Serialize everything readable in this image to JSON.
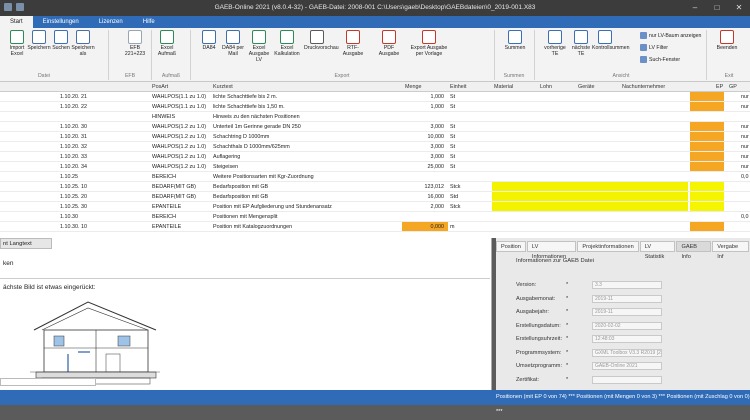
{
  "window": {
    "title": "GAEB-Online 2021 (v8.0.4-32) - GAEB-Datei: 2008-001 C:\\Users\\gaeb\\Desktop\\GAEBdateien\\0_2019-001.X83"
  },
  "menu": [
    "Start",
    "Einstellungen",
    "Lizenzen",
    "Hilfe"
  ],
  "ribbon": {
    "buttons": [
      {
        "label": "Import\nExcel",
        "icon": "import-excel-icon",
        "color": "#2e8b57"
      },
      {
        "label": "Speichern",
        "icon": "save-icon",
        "color": "#4a6fa5"
      },
      {
        "label": "Suchen",
        "icon": "search-icon",
        "color": "#3b6fb8"
      },
      {
        "label": "Speichern\nals",
        "icon": "save-as-icon",
        "color": "#4a6fa5"
      },
      {
        "label": "EFB 221+223",
        "icon": "efb-icon",
        "color": "#9aa6b5"
      },
      {
        "label": "Excel\nAufmaß",
        "icon": "excel-aufmass-icon",
        "color": "#2e8b57"
      },
      {
        "label": "DA84",
        "icon": "da84-icon",
        "color": "#3e6fa8"
      },
      {
        "label": "DA84 per\nMail",
        "icon": "mail-icon",
        "color": "#3e6fa8"
      },
      {
        "label": "Excel\nAusgabe LV",
        "icon": "excel-lv-icon",
        "color": "#2e8b57"
      },
      {
        "label": "Excel\nKalkulation",
        "icon": "excel-calc-icon",
        "color": "#2e8b57"
      },
      {
        "label": "Druckvorschau",
        "icon": "print-preview-icon",
        "color": "#5a5a5a"
      },
      {
        "label": "RTF-Ausgabe",
        "icon": "rtf-icon",
        "color": "#c0392b"
      },
      {
        "label": "PDF Ausgabe",
        "icon": "pdf-icon",
        "color": "#c0392b"
      },
      {
        "label": "Export Ausgabe\nper Vorlage",
        "icon": "template-export-icon",
        "color": "#c0392b"
      },
      {
        "label": "Summen",
        "icon": "sum-icon",
        "color": "#3b6fb8"
      },
      {
        "label": "vorherige\nTE",
        "icon": "prev-icon",
        "color": "#3b6fb8"
      },
      {
        "label": "nächste\nTE",
        "icon": "next-icon",
        "color": "#3b6fb8"
      },
      {
        "label": "Kontrollsummen",
        "icon": "checksum-icon",
        "color": "#3b6fb8"
      },
      {
        "label": "Beenden",
        "icon": "exit-icon",
        "color": "#c0392b"
      }
    ],
    "small": [
      "nur LV-Baum anzeigen",
      "LV Filter",
      "Such-Fenster"
    ],
    "groups": [
      "Datei",
      "EFB",
      "Aufmaß",
      "Export",
      "Summen",
      "Ansicht",
      "Exit"
    ]
  },
  "grid": {
    "headers": [
      "PosArt",
      "Kurztext",
      "Menge",
      "Einheit",
      "Material",
      "Lohn",
      "Geräte",
      "Nachunternehmer",
      "EP",
      "GP"
    ],
    "rows": [
      {
        "oz": "1.10.20.  21",
        "posart": "WAHLPOS(1.1 zu 1.0)",
        "text": "lichte Schachttiefe bis 2 m.",
        "menge": "1,000",
        "einheit": "St",
        "gp": "nur",
        "ep_color": "#f5a623",
        "hl": ""
      },
      {
        "oz": "1.10.20.  22",
        "posart": "WAHLPOS(1.1 zu 1.0)",
        "text": "lichte Schachttiefe bis 1,50 m.",
        "menge": "1,000",
        "einheit": "St",
        "gp": "nur",
        "ep_color": "#f5a623",
        "hl": ""
      },
      {
        "oz": "",
        "posart": "HINWEIS",
        "text": "Hinweis zu den nächsten Positionen",
        "menge": "",
        "einheit": "",
        "gp": "",
        "ep_color": "",
        "hl": ""
      },
      {
        "oz": "1.10.20.  30",
        "posart": "WAHLPOS(1.2 zu 1.0)",
        "text": "Unterteil 1m Gerinne gerade DN 250",
        "menge": "3,000",
        "einheit": "St",
        "gp": "nur",
        "ep_color": "#f5a623",
        "hl": ""
      },
      {
        "oz": "1.10.20.  31",
        "posart": "WAHLPOS(1.2 zu 1.0)",
        "text": "Schachtring D 1000mm",
        "menge": "10,000",
        "einheit": "St",
        "gp": "nur",
        "ep_color": "#f5a623",
        "hl": ""
      },
      {
        "oz": "1.10.20.  32",
        "posart": "WAHLPOS(1.2 zu 1.0)",
        "text": "Schachthals D 1000mm/625mm",
        "menge": "3,000",
        "einheit": "St",
        "gp": "nur",
        "ep_color": "#f5a623",
        "hl": ""
      },
      {
        "oz": "1.10.20.  33",
        "posart": "WAHLPOS(1.2 zu 1.0)",
        "text": "Auflagering",
        "menge": "3,000",
        "einheit": "St",
        "gp": "nur",
        "ep_color": "#f5a623",
        "hl": ""
      },
      {
        "oz": "1.10.20.  34",
        "posart": "WAHLPOS(1.2 zu 1.0)",
        "text": "Steigeisen",
        "menge": "25,000",
        "einheit": "St",
        "gp": "nur",
        "ep_color": "#f5a623",
        "hl": ""
      },
      {
        "oz": "1.10.25",
        "posart": "BEREICH",
        "text": "Weitere Positionsarten mit Kgr-Zuordnung",
        "menge": "",
        "einheit": "",
        "gp": "0,0",
        "ep_color": "",
        "hl": ""
      },
      {
        "oz": "1.10.25.  10",
        "posart": "BEDARF(MIT GB)",
        "text": "Bedarfsposition mit GB",
        "menge": "123,012",
        "einheit": "Stck",
        "gp": "",
        "ep_color": "#f5f500",
        "hl": "yellow"
      },
      {
        "oz": "1.10.25.  20",
        "posart": "BEDARF(MIT GB)",
        "text": "Bedarfsposition mit GB",
        "menge": "16,000",
        "einheit": "Std",
        "gp": "",
        "ep_color": "#f5f500",
        "hl": "yellow"
      },
      {
        "oz": "1.10.25.  30",
        "posart": "EPANTEILE",
        "text": "Position mit EP Aufgliederung und Stundenansatz",
        "menge": "2,000",
        "einheit": "Stck",
        "gp": "",
        "ep_color": "#f5f500",
        "hl": "yellow"
      },
      {
        "oz": "1.10.30",
        "posart": "BEREICH",
        "text": "Positionen mit Mengensplit",
        "menge": "",
        "einheit": "",
        "gp": "0,0",
        "ep_color": "",
        "hl": ""
      },
      {
        "oz": "1.10.30.  10",
        "posart": "EPANTEILE",
        "text": "Position mit Katalogzuordnungen",
        "menge": "0,000",
        "einheit": "m",
        "gp": "",
        "ep_color": "#f5a623",
        "hl": "menge"
      }
    ]
  },
  "leftpane": {
    "tab": "nt Langtext",
    "line1": "ken",
    "line2": "ächste Bild ist etwas eingerückt:"
  },
  "rightpane": {
    "tabs": [
      "Position",
      "LV Informationen",
      "Projektinformationen",
      "LV Statistik",
      "GAEB Info",
      "Vergabe Inf"
    ],
    "heading": "Informationen zur GAEB Datei",
    "fields": [
      {
        "label": "Version:",
        "value": "3.3"
      },
      {
        "label": "Ausgabemonat:",
        "value": "2019-11"
      },
      {
        "label": "Ausgabejahr:",
        "value": "2019-11"
      },
      {
        "label": "Erstellungsdatum:",
        "value": "2020-02-02"
      },
      {
        "label": "Erstellungsuhrzeit:",
        "value": "12:48:03"
      },
      {
        "label": "Programmsystem:",
        "value": "GXML Toolbox V3.3 R2019 [27"
      },
      {
        "label": "Umsetzprogramm:",
        "value": "GAEB-Online 2021"
      },
      {
        "label": "Zertifikat:",
        "value": ""
      }
    ]
  },
  "status": {
    "text": "Positionen (mit EP 0 von 74) *** Positionen (mit Mengen 0 von 3) *** Positionen (mit Zuschlag 0 von 0) ***"
  }
}
